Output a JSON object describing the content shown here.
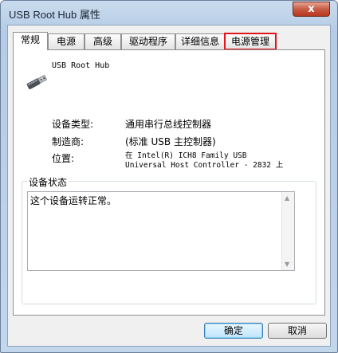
{
  "window": {
    "title": "USB Root Hub 属性",
    "close_label": "x"
  },
  "tabs": [
    {
      "label": "常规"
    },
    {
      "label": "电源"
    },
    {
      "label": "高级"
    },
    {
      "label": "驱动程序"
    },
    {
      "label": "详细信息"
    },
    {
      "label": "电源管理"
    }
  ],
  "general": {
    "device_name": "USB Root Hub",
    "device_type_label": "设备类型:",
    "device_type_value": "通用串行总线控制器",
    "manufacturer_label": "制造商:",
    "manufacturer_value": "(标准 USB 主控制器)",
    "location_label": "位置:",
    "location_value_line1": "在 Intel(R) ICH8 Family USB",
    "location_value_line2": "Universal Host Controller - 2832 上",
    "status_group_title": "设备状态",
    "status_text": "这个设备运转正常。"
  },
  "buttons": {
    "ok": "确定",
    "cancel": "取消"
  },
  "colors": {
    "highlight_border": "#e0141b",
    "close_button": "#c75b43"
  },
  "icons": {
    "device": "usb-plug-icon",
    "scroll_up": "triangle-up",
    "scroll_down": "triangle-down"
  }
}
